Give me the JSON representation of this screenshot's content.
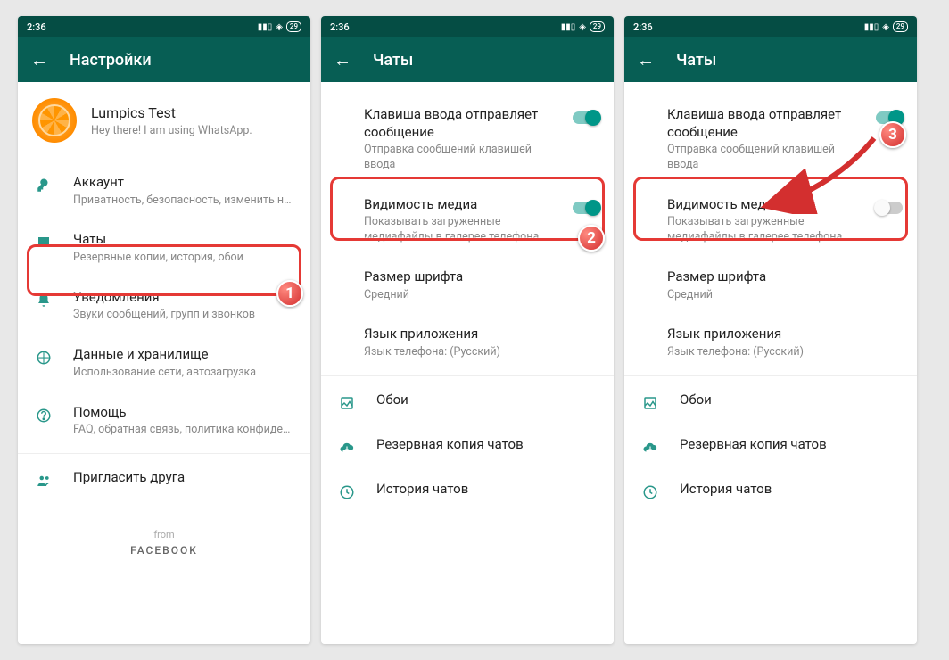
{
  "statusbar": {
    "time": "2:36",
    "battery": "29"
  },
  "screens": [
    {
      "appbar_title": "Настройки",
      "profile": {
        "name": "Lumpics Test",
        "status": "Hey there! I am using WhatsApp."
      },
      "items": [
        {
          "icon": "key",
          "label": "Аккаунт",
          "sub": "Приватность, безопасность, изменить номер"
        },
        {
          "icon": "chat",
          "label": "Чаты",
          "sub": "Резервные копии, история, обои",
          "highlight": true
        },
        {
          "icon": "bell",
          "label": "Уведомления",
          "sub": "Звуки сообщений, групп и звонков"
        },
        {
          "icon": "data",
          "label": "Данные и хранилище",
          "sub": "Использование сети, автозагрузка"
        },
        {
          "icon": "help",
          "label": "Помощь",
          "sub": "FAQ, обратная связь, политика конфиденциальн..."
        },
        {
          "icon": "invite",
          "label": "Пригласить друга",
          "sub": ""
        }
      ],
      "footer": {
        "from": "from",
        "brand": "FACEBOOK"
      }
    },
    {
      "appbar_title": "Чаты",
      "settings": {
        "enter_send": {
          "label": "Клавиша ввода отправляет сообщение",
          "sub": "Отправка сообщений клавишей ввода",
          "on": true
        },
        "media_vis": {
          "label": "Видимость медиа",
          "sub": "Показывать загруженные медиафайлы в галерее телефона",
          "on": true,
          "highlight": true
        },
        "font_size": {
          "label": "Размер шрифта",
          "sub": "Средний"
        },
        "app_lang": {
          "label": "Язык приложения",
          "sub": "Язык телефона: (Русский)"
        }
      },
      "actions": [
        {
          "icon": "wallpaper",
          "label": "Обои"
        },
        {
          "icon": "cloud",
          "label": "Резервная копия чатов"
        },
        {
          "icon": "history",
          "label": "История чатов"
        }
      ]
    },
    {
      "appbar_title": "Чаты",
      "settings": {
        "enter_send": {
          "label": "Клавиша ввода отправляет сообщение",
          "sub": "Отправка сообщений клавишей ввода",
          "on": true
        },
        "media_vis": {
          "label": "Видимость медиа",
          "sub": "Показывать загруженные медиафайлы в галерее телефона",
          "on": false,
          "highlight": true
        },
        "font_size": {
          "label": "Размер шрифта",
          "sub": "Средний"
        },
        "app_lang": {
          "label": "Язык приложения",
          "sub": "Язык телефона: (Русский)"
        }
      },
      "actions": [
        {
          "icon": "wallpaper",
          "label": "Обои"
        },
        {
          "icon": "cloud",
          "label": "Резервная копия чатов"
        },
        {
          "icon": "history",
          "label": "История чатов"
        }
      ]
    }
  ],
  "step_labels": {
    "one": "1",
    "two": "2",
    "three": "3"
  }
}
